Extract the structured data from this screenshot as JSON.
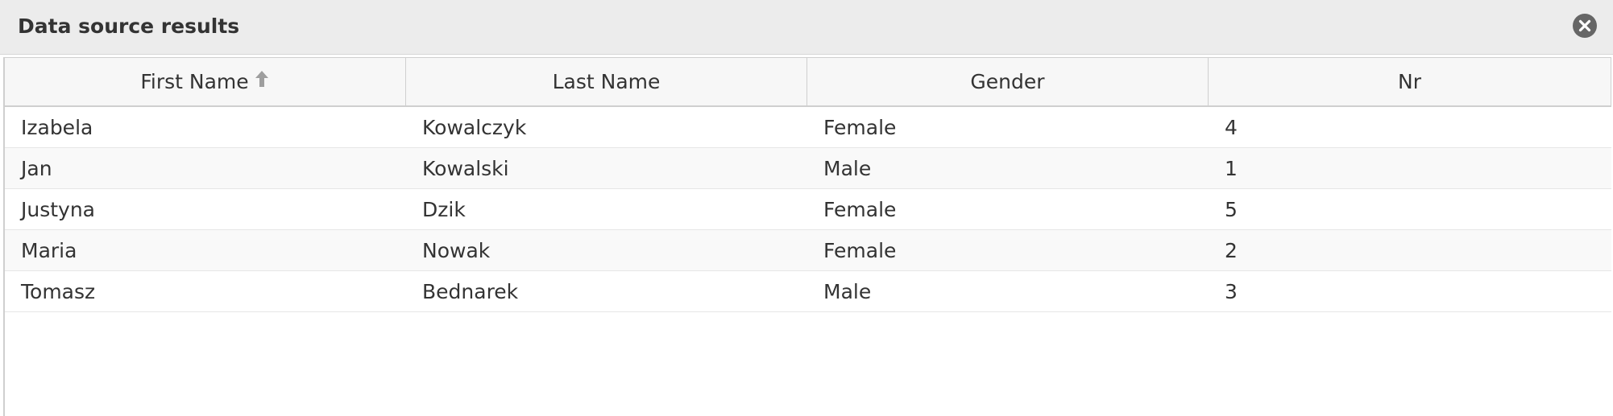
{
  "window": {
    "title": "Data source results",
    "close_icon": "close-circle-icon"
  },
  "table": {
    "columns": [
      {
        "label": "First Name",
        "sort": "ascending",
        "sort_icon": "arrow-up-icon"
      },
      {
        "label": "Last Name"
      },
      {
        "label": "Gender"
      },
      {
        "label": "Nr"
      }
    ],
    "rows": [
      [
        "Izabela",
        "Kowalczyk",
        "Female",
        "4"
      ],
      [
        "Jan",
        "Kowalski",
        "Male",
        "1"
      ],
      [
        "Justyna",
        "Dzik",
        "Female",
        "5"
      ],
      [
        "Maria",
        "Nowak",
        "Female",
        "2"
      ],
      [
        "Tomasz",
        "Bednarek",
        "Male",
        "3"
      ]
    ]
  }
}
